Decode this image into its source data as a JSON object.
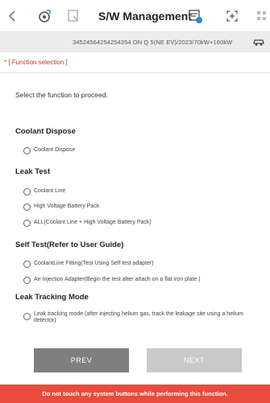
{
  "header": {
    "title": "S/W Management",
    "icons": [
      "back-chevron-icon",
      "settings-refresh-icon",
      "document-icon",
      "report-icon",
      "expand-icon",
      "grid-icon"
    ]
  },
  "info_bar": {
    "text": "34524564254254354   ON Q 5(NE EV)/2023/70kW+160kW",
    "icon": "vehicle-icon"
  },
  "section": {
    "label": "* [ Function selection ]"
  },
  "instruction": "Select the function to proceed.",
  "groups": [
    {
      "title": "Coolant Dispose",
      "options": [
        "Coolant Dispose"
      ]
    },
    {
      "title": "Leak Test",
      "options": [
        "Coolant Line",
        "High Voltage Battery Pack",
        "ALL(Coolant Line + High Voltage Battery Pack)"
      ]
    },
    {
      "title": "Self Test(Refer to User Guide)",
      "options": [
        "CoolantLine Fitting(Test Using Self test adapter)",
        "Air Injection Adapter(Begin the test after attach on a flat iron plate.)"
      ]
    },
    {
      "title": "Leak Tracking Mode",
      "options": [
        "Leak tracking mode (after injecting helium gas, track the leakage site using a helium detector)"
      ]
    }
  ],
  "buttons": {
    "prev": "PREV",
    "next": "NEXT"
  },
  "warning": "Do not touch any system buttons while performing this function.",
  "colors": {
    "accent_red": "#e94b3c",
    "section_label": "#c0392b",
    "prev_bg": "#7f7f7f",
    "next_bg": "#c9c9c9"
  }
}
